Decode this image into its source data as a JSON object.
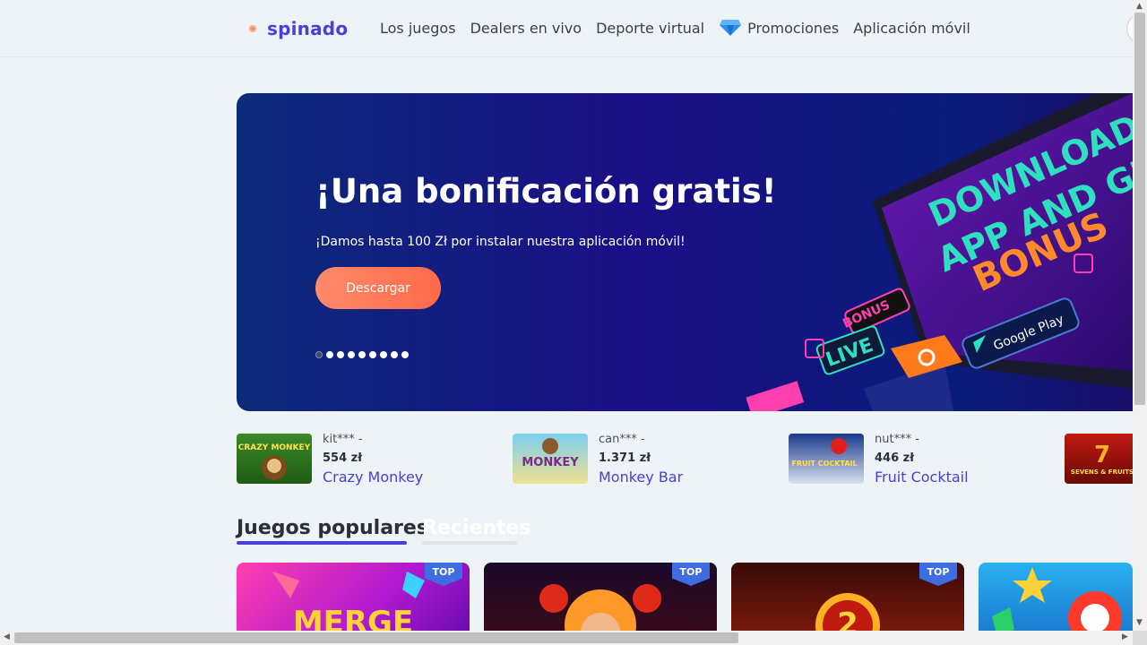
{
  "header": {
    "logo_text": "spinado",
    "nav": [
      {
        "label": "Los juegos"
      },
      {
        "label": "Dealers en vivo"
      },
      {
        "label": "Deporte virtual"
      },
      {
        "label": "Promociones",
        "icon": "diamond-icon"
      },
      {
        "label": "Aplicación móvil"
      }
    ]
  },
  "hero": {
    "title": "¡Una bonificación gratis!",
    "subtitle": "¡Damos hasta 100 Zł por instalar nuestra aplicación móvil!",
    "button_label": "Descargar",
    "slides_count": 9,
    "active_slide": 0,
    "art_text": [
      "DOWNLOAD",
      "APP AND GET",
      "BONUS",
      "LIVE",
      "BONUS",
      "Google Play"
    ]
  },
  "winners": [
    {
      "user": "kit*** -",
      "amount": "554 zł",
      "game": "Crazy Monkey",
      "thumb_text": "CRAZY MONKEY"
    },
    {
      "user": "can*** -",
      "amount": "1.371 zł",
      "game": "Monkey Bar",
      "thumb_text": "MONKEY"
    },
    {
      "user": "nut*** -",
      "amount": "446 zł",
      "game": "Fruit Cocktail",
      "thumb_text": "FRUIT COCKTAIL"
    },
    {
      "user": "",
      "amount": "",
      "game": "",
      "thumb_text": "SEVENS & FRUITS"
    }
  ],
  "tabs": {
    "popular": "Juegos populares",
    "recent": "Recientes"
  },
  "cards": [
    {
      "badge": "TOP",
      "text": "MERGE"
    },
    {
      "badge": "TOP"
    },
    {
      "badge": "TOP"
    },
    {
      "badge": ""
    }
  ],
  "colors": {
    "brand": "#4b3fd9",
    "cta": "#ff7a5a",
    "badge": "#3d6de0"
  }
}
